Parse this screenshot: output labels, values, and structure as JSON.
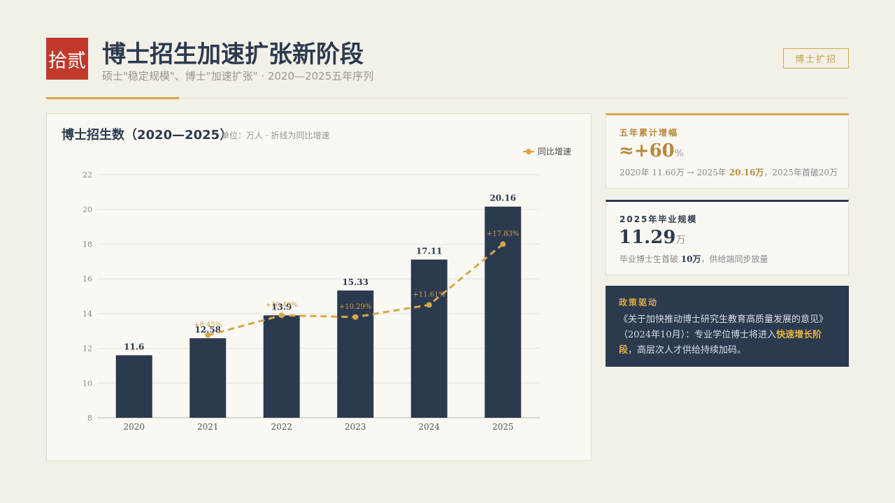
{
  "header": {
    "badge": "拾贰",
    "title": "博士招生加速扩张新阶段",
    "subtitle": "硕士\"稳定规模\"、博士\"加速扩张\"  ·  2020—2025五年序列",
    "tag": "博士扩招"
  },
  "chart_panel": {
    "title": "博士招生数（2020—2025）",
    "note": "单位：万人  ·  折线为同比增速"
  },
  "chart_data": {
    "type": "bar",
    "title": "博士招生数（2020—2025）",
    "categories": [
      "2020",
      "2021",
      "2022",
      "2023",
      "2024",
      "2025"
    ],
    "series": [
      {
        "name": "",
        "type": "bar",
        "values": [
          11.6,
          12.58,
          13.9,
          15.33,
          17.11,
          20.16
        ],
        "labels": [
          "11.6",
          "12.58",
          "13.9",
          "15.33",
          "17.11",
          "20.16"
        ]
      },
      {
        "name": "同比增速",
        "type": "line",
        "values": [
          null,
          12.75,
          13.9,
          13.8,
          14.5,
          18.0
        ],
        "labels": [
          "",
          "+8.45%",
          "+10.49%",
          "+10.29%",
          "+11.61%",
          "+17.83%"
        ]
      }
    ],
    "ylim": [
      8,
      22
    ],
    "yticks": [
      8,
      10,
      12,
      14,
      16,
      18,
      20,
      22
    ],
    "grid": true,
    "legend": "top-right",
    "colors": {
      "bar": "#2b3a4f",
      "line": "#d4a849"
    }
  },
  "cards": {
    "growth": {
      "label": "五年累计增幅",
      "value": "≈+60",
      "unit": "%",
      "desc_a": "2020年 11.60万 → 2025年 ",
      "desc_b": "20.16万",
      "desc_c": "，2025年首破20万"
    },
    "graduates": {
      "label": "2025年毕业规模",
      "value": "11.29",
      "unit": "万",
      "desc_a": "毕业博士生首破 ",
      "desc_b": "10万",
      "desc_c": "，供给端同步放量"
    },
    "policy": {
      "label": "政策驱动",
      "text_a": "《关于加快推动博士研究生教育高质量发展的意见》（2024年10月）：专业学位博士将进入",
      "text_b": "快速增长阶段",
      "text_c": "，高层次人才供给持续加码。"
    }
  }
}
